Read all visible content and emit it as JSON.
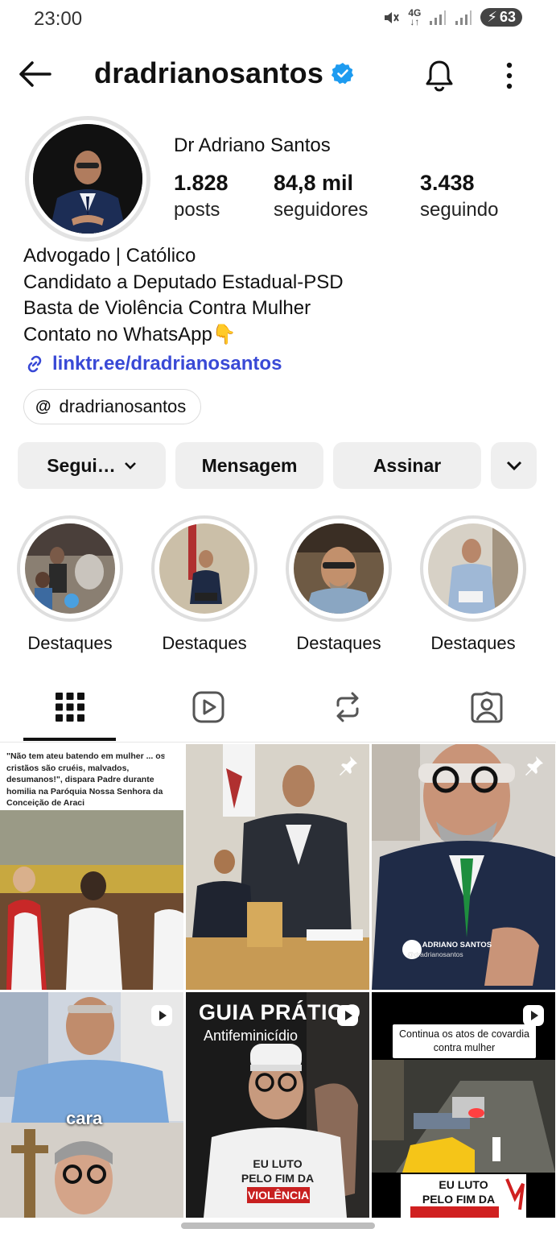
{
  "status_bar": {
    "time": "23:00",
    "network": "4G",
    "battery": "63"
  },
  "header": {
    "username": "dradrianosantos"
  },
  "profile": {
    "full_name": "Dr Adriano Santos",
    "stats": [
      {
        "value": "1.828",
        "label": "posts"
      },
      {
        "value": "84,8 mil",
        "label": "seguidores"
      },
      {
        "value": "3.438",
        "label": "seguindo"
      }
    ],
    "bio": [
      "Advogado | Católico",
      "Candidato a Deputado Estadual-PSD",
      "Basta de Violência Contra Mulher",
      "Contato no WhatsApp👇"
    ],
    "link": "linktr.ee/dradrianosantos",
    "threads_handle": "dradrianosantos"
  },
  "actions": {
    "follow": "Segui…",
    "message": "Mensagem",
    "subscribe": "Assinar"
  },
  "highlights": [
    {
      "label": "Destaques"
    },
    {
      "label": "Destaques"
    },
    {
      "label": "Destaques"
    },
    {
      "label": "Destaques"
    }
  ],
  "tabs": [
    "grid-icon",
    "reels-icon",
    "reposts-icon",
    "tagged-icon"
  ],
  "posts": {
    "p1_caption": "\"Não tem ateu batendo em mulher ... os cristãos são cruéis, malvados, desumanos!\", dispara Padre durante homilia na Paróquia Nossa Senhora da Conceição de Araci",
    "p3_tag": "DR. ADRIANO SANTOS",
    "p3_handle": "@dradrianosantos",
    "p4_word": "cara",
    "p5_title": "GUIA PRÁTICO",
    "p5_subtitle": "Antifeminicídio",
    "p6_caption": "Continua os atos de covardia contra mulher"
  },
  "colors": {
    "accent_link": "#3949d6",
    "verified": "#1d9bf0",
    "button_bg": "#efefef"
  }
}
